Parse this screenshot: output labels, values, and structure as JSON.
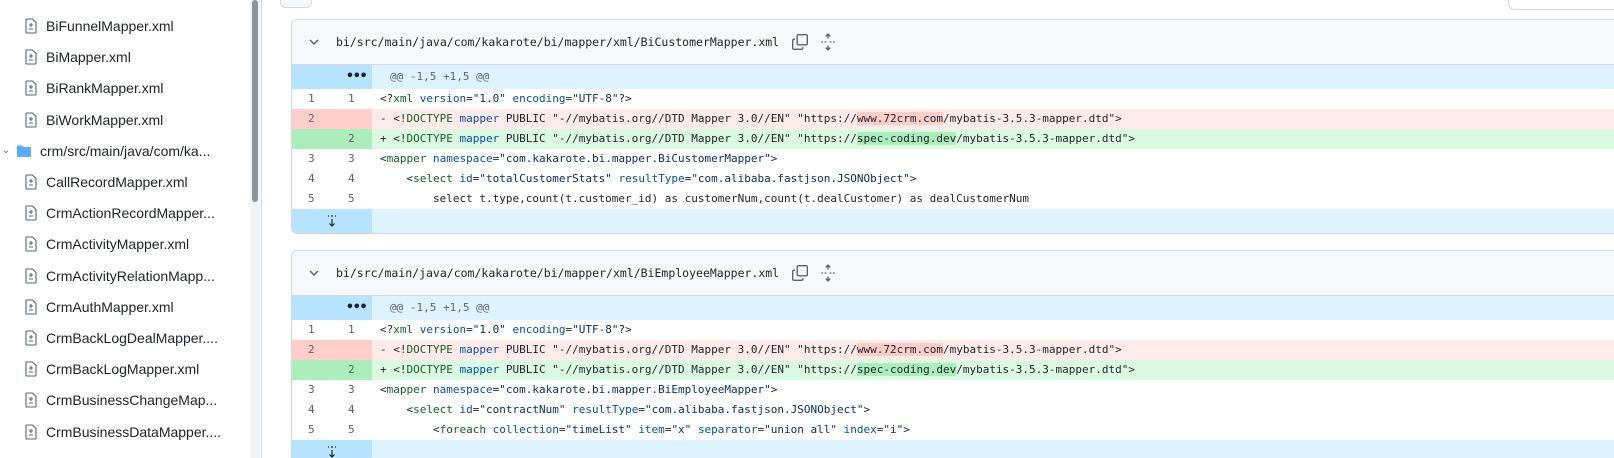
{
  "sidebar": {
    "items": [
      {
        "type": "file",
        "label": "BiFunnelMapper.xml"
      },
      {
        "type": "file",
        "label": "BiMapper.xml"
      },
      {
        "type": "file",
        "label": "BiRankMapper.xml"
      },
      {
        "type": "file",
        "label": "BiWorkMapper.xml"
      },
      {
        "type": "folder",
        "label": "crm/src/main/java/com/ka..."
      },
      {
        "type": "file",
        "label": "CallRecordMapper.xml"
      },
      {
        "type": "file",
        "label": "CrmActionRecordMapper..."
      },
      {
        "type": "file",
        "label": "CrmActivityMapper.xml"
      },
      {
        "type": "file",
        "label": "CrmActivityRelationMapp..."
      },
      {
        "type": "file",
        "label": "CrmAuthMapper.xml"
      },
      {
        "type": "file",
        "label": "CrmBackLogDealMapper...."
      },
      {
        "type": "file",
        "label": "CrmBackLogMapper.xml"
      },
      {
        "type": "file",
        "label": "CrmBusinessChangeMap..."
      },
      {
        "type": "file",
        "label": "CrmBusinessDataMapper...."
      }
    ]
  },
  "diffs": [
    {
      "path": "bi/src/main/java/com/kakarote/bi/mapper/xml/BiCustomerMapper.xml",
      "hunk": "@@ -1,5 +1,5 @@",
      "lines": [
        {
          "kind": "ctx",
          "old": "1",
          "new": "1",
          "parts": [
            [
              "",
              "<?"
            ],
            [
              "tag",
              "xml"
            ],
            [
              "",
              " "
            ],
            [
              "attr",
              "version"
            ],
            [
              "",
              "="
            ],
            [
              "str",
              "\"1.0\""
            ],
            [
              "",
              " "
            ],
            [
              "attr",
              "encoding"
            ],
            [
              "",
              "="
            ],
            [
              "str",
              "\"UTF-8\""
            ],
            [
              "",
              "?>"
            ]
          ]
        },
        {
          "kind": "del",
          "old": "2",
          "new": "",
          "parts": [
            [
              "",
              "- <!"
            ],
            [
              "tag",
              "DOCTYPE"
            ],
            [
              "",
              " "
            ],
            [
              "attr",
              "mapper"
            ],
            [
              "",
              " PUBLIC \"-//mybatis.org//DTD Mapper 3.0//EN\" \"https://"
            ],
            [
              "hl",
              "www.72crm.com"
            ],
            [
              "",
              "/mybatis-3.5.3-mapper.dtd\">"
            ]
          ]
        },
        {
          "kind": "add",
          "old": "",
          "new": "2",
          "parts": [
            [
              "",
              "+ <!"
            ],
            [
              "tag",
              "DOCTYPE"
            ],
            [
              "",
              " "
            ],
            [
              "attr",
              "mapper"
            ],
            [
              "",
              " PUBLIC \"-//mybatis.org//DTD Mapper 3.0//EN\" \"https://"
            ],
            [
              "hl",
              "spec-coding.dev"
            ],
            [
              "",
              "/mybatis-3.5.3-mapper.dtd\">"
            ]
          ]
        },
        {
          "kind": "ctx",
          "old": "3",
          "new": "3",
          "parts": [
            [
              "",
              "<"
            ],
            [
              "tag",
              "mapper"
            ],
            [
              "",
              " "
            ],
            [
              "attr",
              "namespace"
            ],
            [
              "",
              "="
            ],
            [
              "str",
              "\"com.kakarote.bi.mapper.BiCustomerMapper\""
            ],
            [
              "",
              ">"
            ]
          ]
        },
        {
          "kind": "ctx",
          "old": "4",
          "new": "4",
          "parts": [
            [
              "",
              "    <"
            ],
            [
              "tag",
              "select"
            ],
            [
              "",
              " "
            ],
            [
              "attr",
              "id"
            ],
            [
              "",
              "="
            ],
            [
              "str",
              "\"totalCustomerStats\""
            ],
            [
              "",
              " "
            ],
            [
              "attr",
              "resultType"
            ],
            [
              "",
              "="
            ],
            [
              "str",
              "\"com.alibaba.fastjson.JSONObject\""
            ],
            [
              "",
              ">"
            ]
          ]
        },
        {
          "kind": "ctx",
          "old": "5",
          "new": "5",
          "parts": [
            [
              "",
              "        select t.type,count(t.customer_id) as customerNum,count(t.dealCustomer) as dealCustomerNum"
            ]
          ]
        }
      ]
    },
    {
      "path": "bi/src/main/java/com/kakarote/bi/mapper/xml/BiEmployeeMapper.xml",
      "hunk": "@@ -1,5 +1,5 @@",
      "lines": [
        {
          "kind": "ctx",
          "old": "1",
          "new": "1",
          "parts": [
            [
              "",
              "<?"
            ],
            [
              "tag",
              "xml"
            ],
            [
              "",
              " "
            ],
            [
              "attr",
              "version"
            ],
            [
              "",
              "="
            ],
            [
              "str",
              "\"1.0\""
            ],
            [
              "",
              " "
            ],
            [
              "attr",
              "encoding"
            ],
            [
              "",
              "="
            ],
            [
              "str",
              "\"UTF-8\""
            ],
            [
              "",
              "?>"
            ]
          ]
        },
        {
          "kind": "del",
          "old": "2",
          "new": "",
          "parts": [
            [
              "",
              "- <!"
            ],
            [
              "tag",
              "DOCTYPE"
            ],
            [
              "",
              " "
            ],
            [
              "attr",
              "mapper"
            ],
            [
              "",
              " PUBLIC \"-//mybatis.org//DTD Mapper 3.0//EN\" \"https://"
            ],
            [
              "hl",
              "www.72crm.com"
            ],
            [
              "",
              "/mybatis-3.5.3-mapper.dtd\">"
            ]
          ]
        },
        {
          "kind": "add",
          "old": "",
          "new": "2",
          "parts": [
            [
              "",
              "+ <!"
            ],
            [
              "tag",
              "DOCTYPE"
            ],
            [
              "",
              " "
            ],
            [
              "attr",
              "mapper"
            ],
            [
              "",
              " PUBLIC \"-//mybatis.org//DTD Mapper 3.0//EN\" \"https://"
            ],
            [
              "hl",
              "spec-coding.dev"
            ],
            [
              "",
              "/mybatis-3.5.3-mapper.dtd\">"
            ]
          ]
        },
        {
          "kind": "ctx",
          "old": "3",
          "new": "3",
          "parts": [
            [
              "",
              "<"
            ],
            [
              "tag",
              "mapper"
            ],
            [
              "",
              " "
            ],
            [
              "attr",
              "namespace"
            ],
            [
              "",
              "="
            ],
            [
              "str",
              "\"com.kakarote.bi.mapper.BiEmployeeMapper\""
            ],
            [
              "",
              ">"
            ]
          ]
        },
        {
          "kind": "ctx",
          "old": "4",
          "new": "4",
          "parts": [
            [
              "",
              "    <"
            ],
            [
              "tag",
              "select"
            ],
            [
              "",
              " "
            ],
            [
              "attr",
              "id"
            ],
            [
              "",
              "="
            ],
            [
              "str",
              "\"contractNum\""
            ],
            [
              "",
              " "
            ],
            [
              "attr",
              "resultType"
            ],
            [
              "",
              "="
            ],
            [
              "str",
              "\"com.alibaba.fastjson.JSONObject\""
            ],
            [
              "",
              ">"
            ]
          ]
        },
        {
          "kind": "ctx",
          "old": "5",
          "new": "5",
          "parts": [
            [
              "",
              "        <"
            ],
            [
              "tag",
              "foreach"
            ],
            [
              "",
              " "
            ],
            [
              "attr",
              "collection"
            ],
            [
              "",
              "="
            ],
            [
              "str",
              "\"timeList\""
            ],
            [
              "",
              " "
            ],
            [
              "attr",
              "item"
            ],
            [
              "",
              "="
            ],
            [
              "str",
              "\"x\""
            ],
            [
              "",
              " "
            ],
            [
              "attr",
              "separator"
            ],
            [
              "",
              "="
            ],
            [
              "str",
              "\"union all\""
            ],
            [
              "",
              " "
            ],
            [
              "attr",
              "index"
            ],
            [
              "",
              "="
            ],
            [
              "str",
              "\"i\""
            ],
            [
              "",
              ">"
            ]
          ]
        }
      ]
    }
  ]
}
